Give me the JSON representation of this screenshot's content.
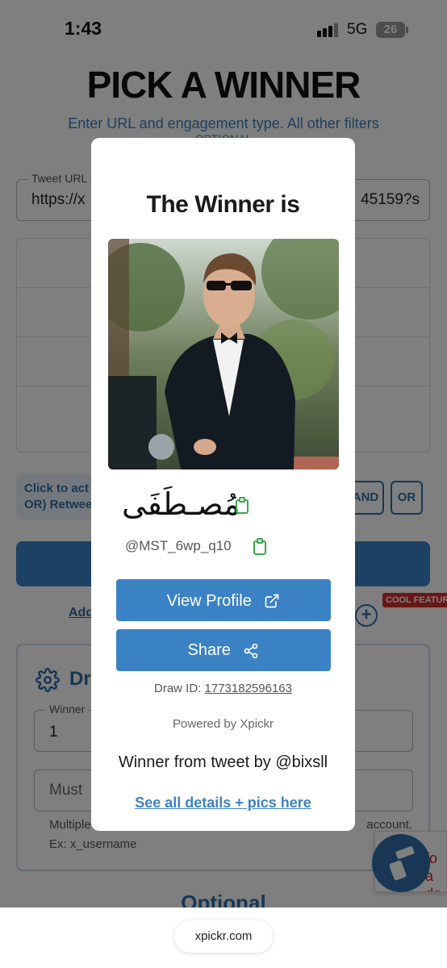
{
  "status": {
    "time": "1:43",
    "network": "5G",
    "battery": "26"
  },
  "page": {
    "title": "PICK A WINNER",
    "subtitle": "Enter URL and engagement type. All other filters",
    "subtitle_cont": "OPTIONAL",
    "tweet_label": "Tweet URL",
    "tweet_value": "https://x",
    "tweet_value_end": "45159?s",
    "hint": "Click to act",
    "hint_line2": "OR) Retwee",
    "and_label": "AND",
    "or_label": "OR",
    "add_link": "Add",
    "cool_feature": "COOL FEATURE",
    "draw_title": "Dra",
    "winners_label": "Winner",
    "winners_value": "1",
    "must_placeholder": "Must",
    "help_line1": "Multiple",
    "help_line1_end": "account.",
    "help_line2": "Ex: x_username",
    "optional": "Optional",
    "widget_text_1": "fo",
    "widget_text_2": "a do"
  },
  "modal": {
    "title": "The Winner is",
    "winner_name": "مُصـطَفَى",
    "winner_handle": "@MST_6wp_q10",
    "view_profile": "View Profile",
    "share": "Share",
    "draw_id_label": "Draw ID: ",
    "draw_id": "1773182596163",
    "powered_by": "Powered by Xpickr",
    "source": "Winner from tweet by @bixsll",
    "details_link": "See all details + pics here"
  },
  "browser": {
    "url": "xpickr.com"
  },
  "colors": {
    "accent": "#3b82c4",
    "copy_icon": "#3aa64a",
    "badge": "#d12e2e"
  }
}
